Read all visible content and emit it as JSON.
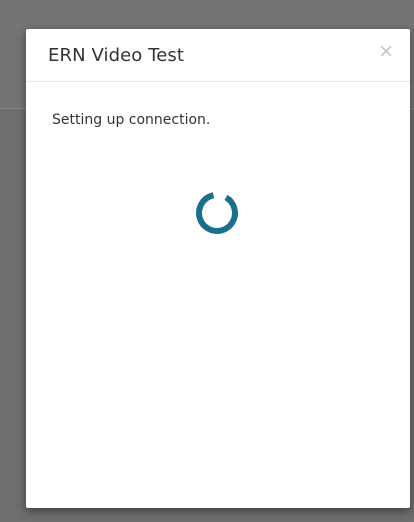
{
  "modal": {
    "title": "ERN Video Test",
    "close_label": "×",
    "status_text": "Setting up connection.",
    "spinner_color": "#1a6e8e"
  }
}
